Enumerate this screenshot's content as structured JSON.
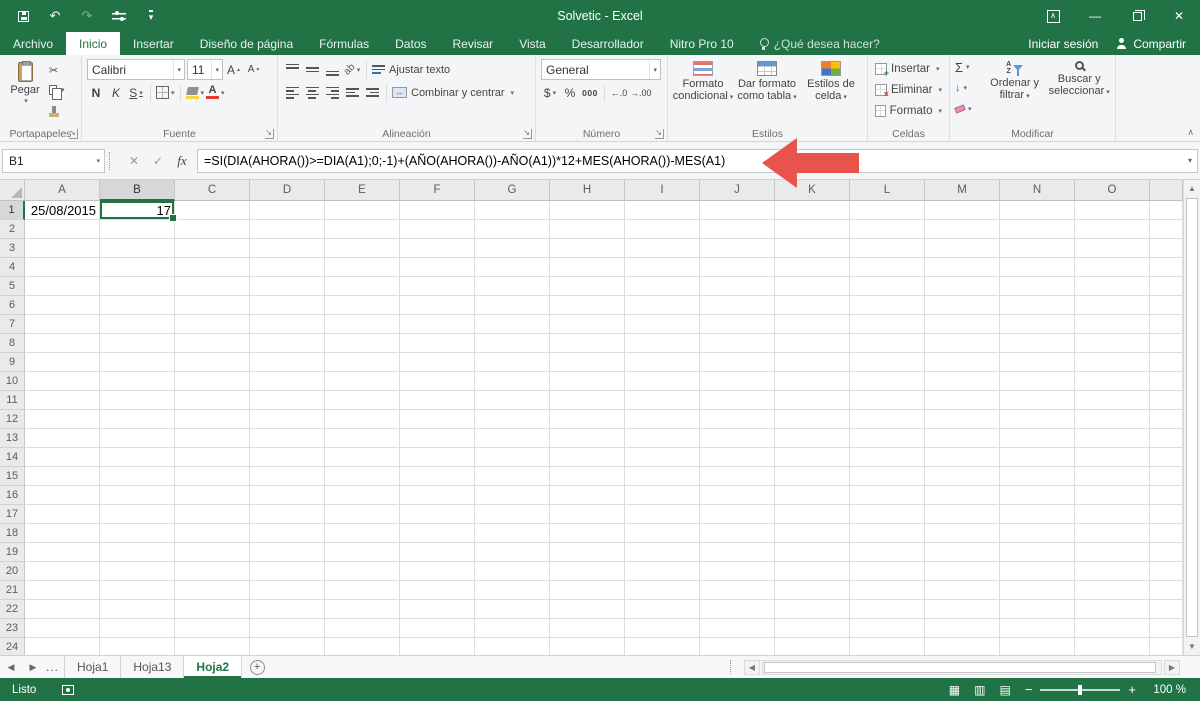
{
  "colors": {
    "excel_green": "#217346",
    "arrow_red": "#e8534b",
    "fill_yellow": "#f7d842",
    "font_red": "#e03c31"
  },
  "titlebar": {
    "title": "Solvetic - Excel"
  },
  "ribbon_tabs": {
    "items": [
      {
        "label": "Archivo",
        "file": true
      },
      {
        "label": "Inicio",
        "active": true
      },
      {
        "label": "Insertar"
      },
      {
        "label": "Diseño de página"
      },
      {
        "label": "Fórmulas"
      },
      {
        "label": "Datos"
      },
      {
        "label": "Revisar"
      },
      {
        "label": "Vista"
      },
      {
        "label": "Desarrollador"
      },
      {
        "label": "Nitro Pro 10"
      }
    ],
    "tell_me": "¿Qué desea hacer?",
    "sign_in": "Iniciar sesión",
    "share": "Compartir"
  },
  "ribbon": {
    "clipboard": {
      "group": "Portapapeles",
      "paste": "Pegar"
    },
    "font": {
      "group": "Fuente",
      "family": "Calibri",
      "size": "11",
      "bold": "N",
      "italic": "K",
      "underline": "S"
    },
    "alignment": {
      "group": "Alineación",
      "wrap": "Ajustar texto",
      "merge": "Combinar y centrar"
    },
    "number": {
      "group": "Número",
      "format": "General",
      "thousands": "000",
      "inc_dec": "←.0",
      "dec_dec": "→.00"
    },
    "styles": {
      "group": "Estilos",
      "conditional": {
        "l1": "Formato",
        "l2": "condicional"
      },
      "as_table": {
        "l1": "Dar formato",
        "l2": "como tabla"
      },
      "cell_styles": {
        "l1": "Estilos de",
        "l2": "celda"
      }
    },
    "cells": {
      "group": "Celdas",
      "insert": "Insertar",
      "delete": "Eliminar",
      "format": "Formato"
    },
    "editing": {
      "group": "Modificar",
      "sort": {
        "l1": "Ordenar y",
        "l2": "filtrar"
      },
      "find": {
        "l1": "Buscar y",
        "l2": "seleccionar"
      }
    }
  },
  "formula_bar": {
    "name_box": "B1",
    "fx": "fx",
    "formula": "=SI(DIA(AHORA())>=DIA(A1);0;-1)+(AÑO(AHORA())-AÑO(A1))*12+MES(AHORA())-MES(A1)"
  },
  "grid": {
    "columns": [
      "A",
      "B",
      "C",
      "D",
      "E",
      "F",
      "G",
      "H",
      "I",
      "J",
      "K",
      "L",
      "M",
      "N",
      "O"
    ],
    "row_count": 24,
    "active_cell": "B1",
    "active_column": "B",
    "active_row": 1,
    "cells": {
      "A1": "25/08/2015",
      "B1": "17"
    }
  },
  "sheet_tabs": {
    "more": "...",
    "tabs": [
      {
        "label": "Hoja1"
      },
      {
        "label": "Hoja13"
      },
      {
        "label": "Hoja2",
        "active": true
      }
    ]
  },
  "status_bar": {
    "mode": "Listo",
    "zoom": "100 %"
  }
}
